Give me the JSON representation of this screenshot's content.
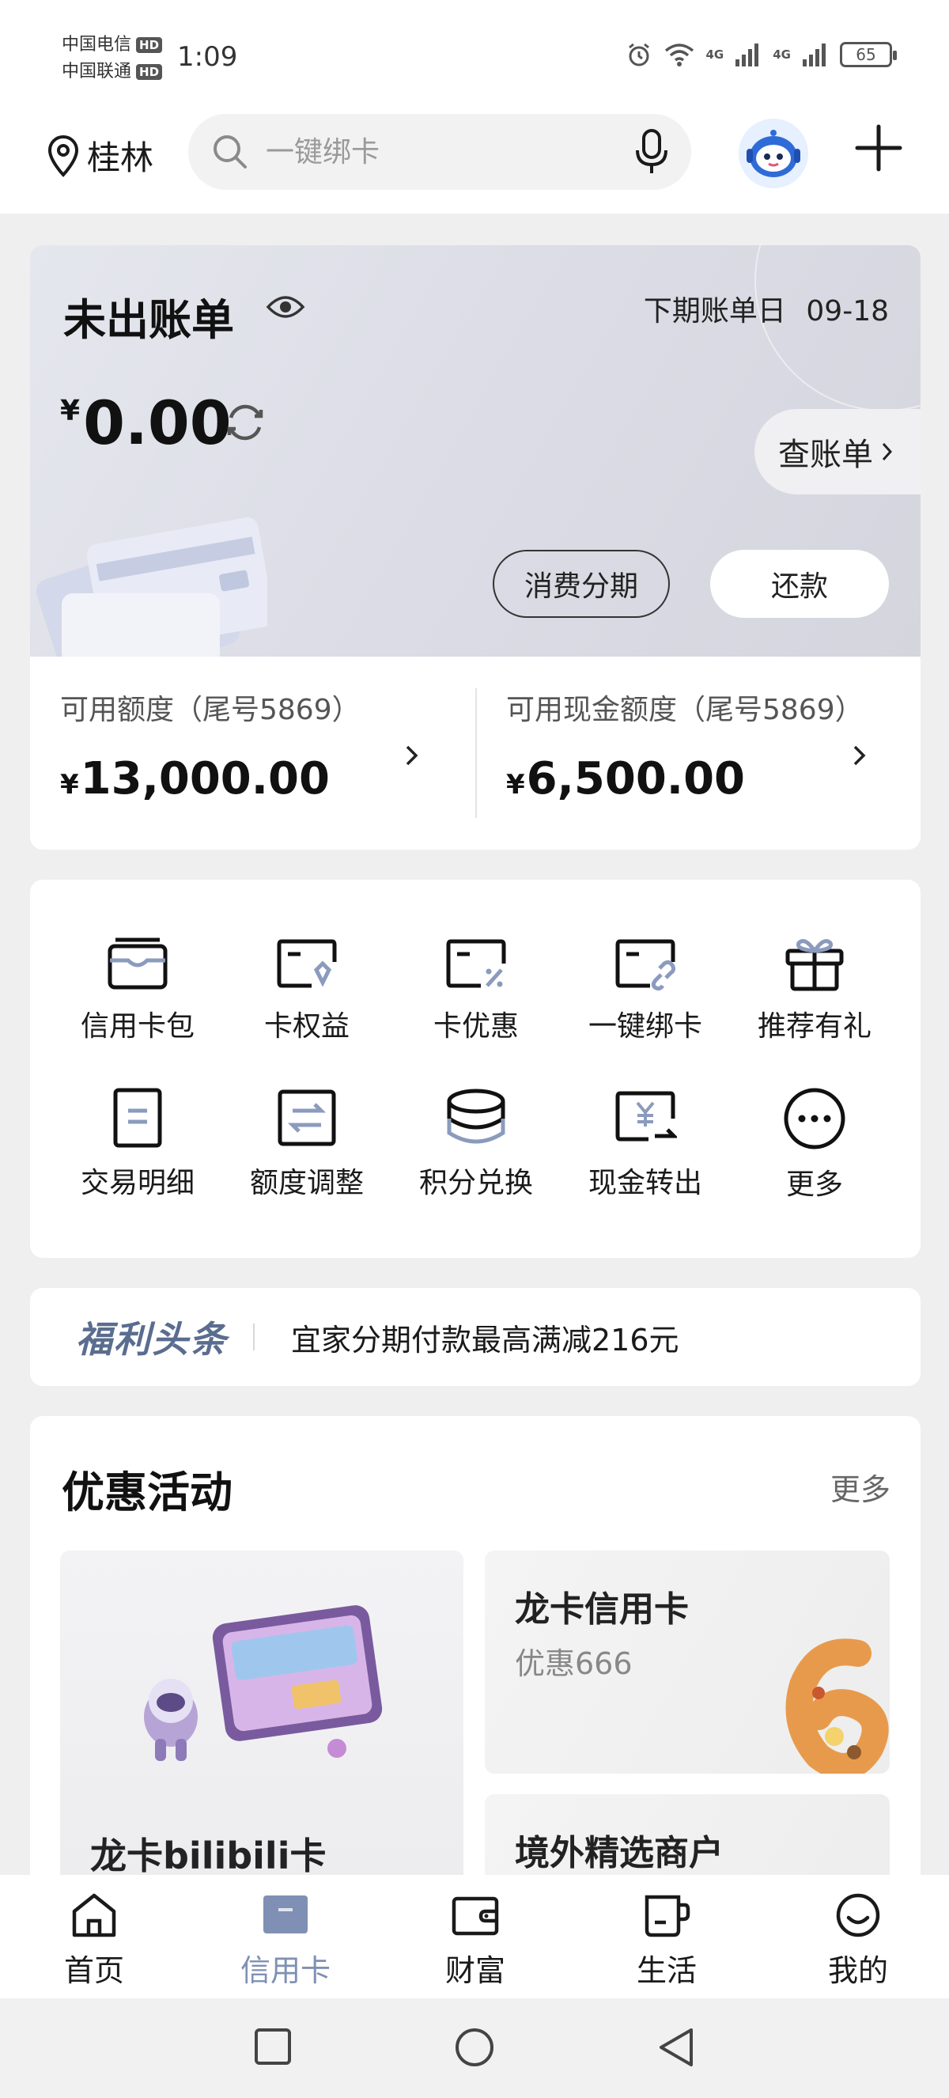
{
  "status_bar": {
    "carrier_1": "中国电信",
    "carrier_2": "中国联通",
    "hd_badge": "HD",
    "time": "1:09",
    "network_1": "4G",
    "network_2": "4G",
    "battery": "65"
  },
  "header": {
    "location": "桂林",
    "search_placeholder": "一键绑卡"
  },
  "bill": {
    "title": "未出账单",
    "next_bill_label": "下期账单日",
    "next_bill_date": "09-18",
    "currency": "¥",
    "amount": "0.00",
    "check_bill": "查账单",
    "installment": "消费分期",
    "repay": "还款"
  },
  "limits": {
    "available_label": "可用额度（尾号5869）",
    "available_currency": "¥",
    "available_amount": "13,000.00",
    "cash_label": "可用现金额度（尾号5869）",
    "cash_currency": "¥",
    "cash_amount": "6,500.00"
  },
  "functions": [
    {
      "label": "信用卡包",
      "icon": "card-wallet-icon"
    },
    {
      "label": "卡权益",
      "icon": "card-rights-icon"
    },
    {
      "label": "卡优惠",
      "icon": "card-discount-icon"
    },
    {
      "label": "一键绑卡",
      "icon": "card-bind-icon"
    },
    {
      "label": "推荐有礼",
      "icon": "gift-icon"
    },
    {
      "label": "交易明细",
      "icon": "transaction-detail-icon"
    },
    {
      "label": "额度调整",
      "icon": "limit-adjust-icon"
    },
    {
      "label": "积分兑换",
      "icon": "points-exchange-icon"
    },
    {
      "label": "现金转出",
      "icon": "cash-transfer-icon"
    },
    {
      "label": "更多",
      "icon": "more-icon"
    }
  ],
  "news": {
    "badge": "福利头条",
    "text": "宜家分期付款最高满减216元"
  },
  "promotions": {
    "title": "优惠活动",
    "more": "更多",
    "items": [
      {
        "title": "龙卡bilibili卡"
      },
      {
        "title": "龙卡信用卡",
        "subtitle": "优惠666"
      },
      {
        "title": "境外精选商户"
      }
    ]
  },
  "bottom_nav": [
    {
      "label": "首页",
      "icon": "home-icon"
    },
    {
      "label": "信用卡",
      "icon": "credit-card-icon",
      "active": true
    },
    {
      "label": "财富",
      "icon": "wallet-icon"
    },
    {
      "label": "生活",
      "icon": "cup-icon"
    },
    {
      "label": "我的",
      "icon": "smile-icon"
    }
  ],
  "colors": {
    "accent": "#7f90b4",
    "news_badge": "#5a6d8f",
    "page_bg": "#efefef"
  }
}
